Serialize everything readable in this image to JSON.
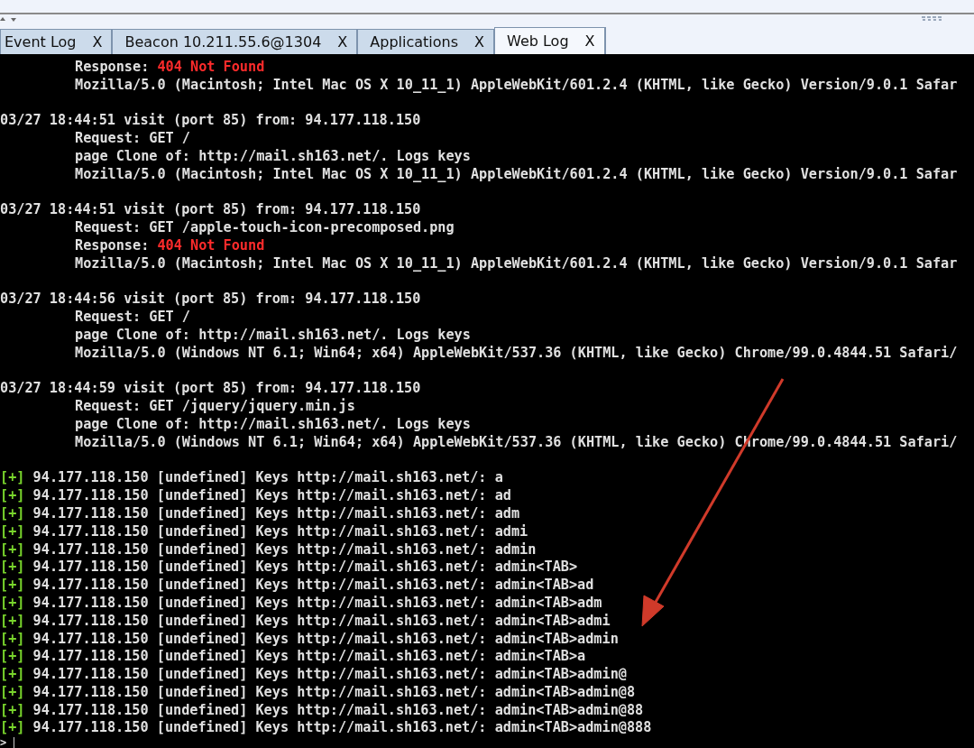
{
  "tabs": [
    {
      "label": "Event Log",
      "close": "X",
      "selected": false
    },
    {
      "label": "Beacon 10.211.55.6@1304",
      "close": "X",
      "selected": false
    },
    {
      "label": "Applications",
      "close": "X",
      "selected": false
    },
    {
      "label": "Web Log",
      "close": "X",
      "selected": true
    }
  ],
  "log": {
    "groups": [
      {
        "lines": [
          {
            "kind": "response",
            "label": "Response:",
            "status": "404 Not Found"
          },
          {
            "kind": "detail",
            "text": "Mozilla/5.0 (Macintosh; Intel Mac OS X 10_11_1) AppleWebKit/601.2.4 (KHTML, like Gecko) Version/9.0.1 Safar"
          }
        ]
      },
      {
        "header": "03/27 18:44:51 visit (port 85) from: 94.177.118.150",
        "lines": [
          {
            "kind": "detail",
            "text": "Request: GET /"
          },
          {
            "kind": "detail",
            "text": "page Clone of: http://mail.sh163.net/. Logs keys"
          },
          {
            "kind": "detail",
            "text": "Mozilla/5.0 (Macintosh; Intel Mac OS X 10_11_1) AppleWebKit/601.2.4 (KHTML, like Gecko) Version/9.0.1 Safar"
          }
        ]
      },
      {
        "header": "03/27 18:44:51 visit (port 85) from: 94.177.118.150",
        "lines": [
          {
            "kind": "detail",
            "text": "Request: GET /apple-touch-icon-precomposed.png"
          },
          {
            "kind": "response",
            "label": "Response:",
            "status": "404 Not Found"
          },
          {
            "kind": "detail",
            "text": "Mozilla/5.0 (Macintosh; Intel Mac OS X 10_11_1) AppleWebKit/601.2.4 (KHTML, like Gecko) Version/9.0.1 Safar"
          }
        ]
      },
      {
        "header": "03/27 18:44:56 visit (port 85) from: 94.177.118.150",
        "lines": [
          {
            "kind": "detail",
            "text": "Request: GET /"
          },
          {
            "kind": "detail",
            "text": "page Clone of: http://mail.sh163.net/. Logs keys"
          },
          {
            "kind": "detail",
            "text": "Mozilla/5.0 (Windows NT 6.1; Win64; x64) AppleWebKit/537.36 (KHTML, like Gecko) Chrome/99.0.4844.51 Safari/"
          }
        ]
      },
      {
        "header": "03/27 18:44:59 visit (port 85) from: 94.177.118.150",
        "lines": [
          {
            "kind": "detail",
            "text": "Request: GET /jquery/jquery.min.js"
          },
          {
            "kind": "detail",
            "text": "page Clone of: http://mail.sh163.net/. Logs keys"
          },
          {
            "kind": "detail",
            "text": "Mozilla/5.0 (Windows NT 6.1; Win64; x64) AppleWebKit/537.36 (KHTML, like Gecko) Chrome/99.0.4844.51 Safari/"
          }
        ]
      }
    ],
    "keys": [
      {
        "marker": "[+]",
        "text": "94.177.118.150 [undefined] Keys http://mail.sh163.net/: a"
      },
      {
        "marker": "[+]",
        "text": "94.177.118.150 [undefined] Keys http://mail.sh163.net/: ad"
      },
      {
        "marker": "[+]",
        "text": "94.177.118.150 [undefined] Keys http://mail.sh163.net/: adm"
      },
      {
        "marker": "[+]",
        "text": "94.177.118.150 [undefined] Keys http://mail.sh163.net/: admi"
      },
      {
        "marker": "[+]",
        "text": "94.177.118.150 [undefined] Keys http://mail.sh163.net/: admin"
      },
      {
        "marker": "[+]",
        "text": "94.177.118.150 [undefined] Keys http://mail.sh163.net/: admin<TAB>"
      },
      {
        "marker": "[+]",
        "text": "94.177.118.150 [undefined] Keys http://mail.sh163.net/: admin<TAB>ad"
      },
      {
        "marker": "[+]",
        "text": "94.177.118.150 [undefined] Keys http://mail.sh163.net/: admin<TAB>adm"
      },
      {
        "marker": "[+]",
        "text": "94.177.118.150 [undefined] Keys http://mail.sh163.net/: admin<TAB>admi"
      },
      {
        "marker": "[+]",
        "text": "94.177.118.150 [undefined] Keys http://mail.sh163.net/: admin<TAB>admin"
      },
      {
        "marker": "[+]",
        "text": "94.177.118.150 [undefined] Keys http://mail.sh163.net/: admin<TAB>a"
      },
      {
        "marker": "[+]",
        "text": "94.177.118.150 [undefined] Keys http://mail.sh163.net/: admin<TAB>admin@"
      },
      {
        "marker": "[+]",
        "text": "94.177.118.150 [undefined] Keys http://mail.sh163.net/: admin<TAB>admin@8"
      },
      {
        "marker": "[+]",
        "text": "94.177.118.150 [undefined] Keys http://mail.sh163.net/: admin<TAB>admin@88"
      },
      {
        "marker": "[+]",
        "text": "94.177.118.150 [undefined] Keys http://mail.sh163.net/: admin<TAB>admin@888"
      }
    ],
    "prompt": ">"
  }
}
